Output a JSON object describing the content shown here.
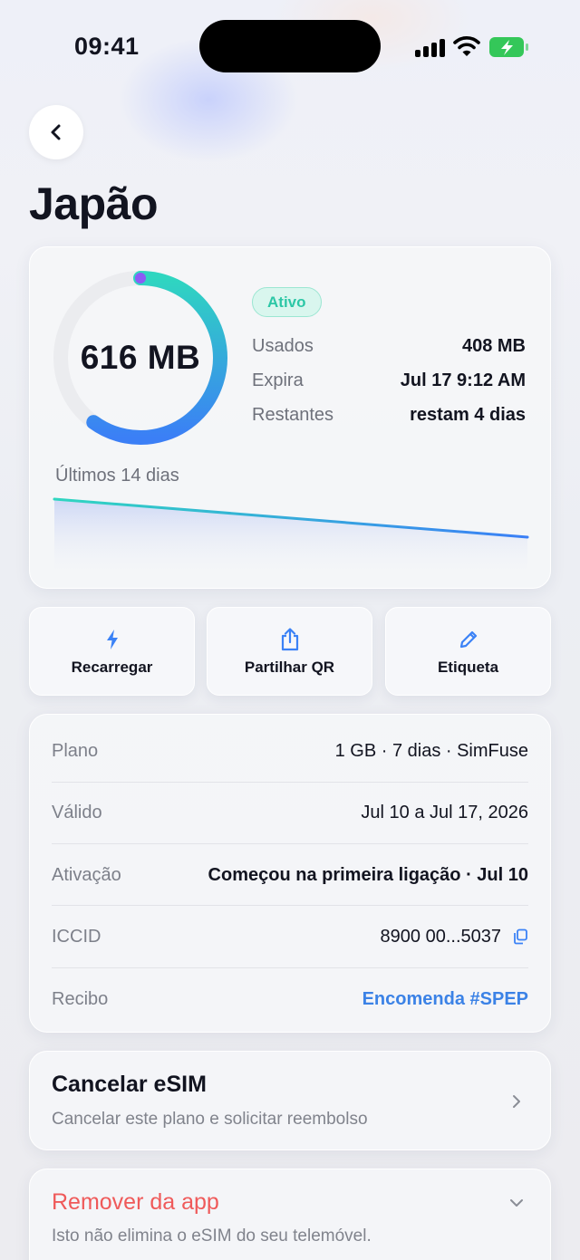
{
  "status_bar": {
    "time": "09:41"
  },
  "header": {
    "title": "Japão"
  },
  "usage": {
    "remaining_display": "616 MB",
    "remaining_fraction": 0.6,
    "status_badge": "Ativo",
    "stats": [
      {
        "label": "Usados",
        "value": "408 MB"
      },
      {
        "label": "Expira",
        "value": "Jul 17 9:12 AM"
      },
      {
        "label": "Restantes",
        "value": "restam 4 dias"
      }
    ],
    "history_label": "Últimos 14 dias"
  },
  "actions": [
    {
      "label": "Recarregar",
      "icon": "bolt-icon"
    },
    {
      "label": "Partilhar QR",
      "icon": "share-icon"
    },
    {
      "label": "Etiqueta",
      "icon": "pencil-icon"
    }
  ],
  "details": {
    "plan": {
      "label": "Plano",
      "value": "1 GB · 7 dias · SimFuse"
    },
    "valid": {
      "label": "Válido",
      "value": "Jul 10 a Jul 17, 2026"
    },
    "activation": {
      "label": "Ativação",
      "value": "Começou na primeira ligação · Jul 10"
    },
    "iccid": {
      "label": "ICCID",
      "value": "8900 00...5037"
    },
    "receipt": {
      "label": "Recibo",
      "value": "Encomenda #SPEP"
    }
  },
  "cancel": {
    "title": "Cancelar eSIM",
    "subtitle": "Cancelar este plano e solicitar reembolso"
  },
  "remove": {
    "title": "Remover da app",
    "subtitle": "Isto não elimina o eSIM do seu telemóvel."
  },
  "colors": {
    "accent_teal": "#2fd3c0",
    "accent_blue": "#3b82f6",
    "badge_text": "#2cc7a6",
    "link": "#3b82e6",
    "danger": "#ef5a5a",
    "battery": "#34c759"
  }
}
